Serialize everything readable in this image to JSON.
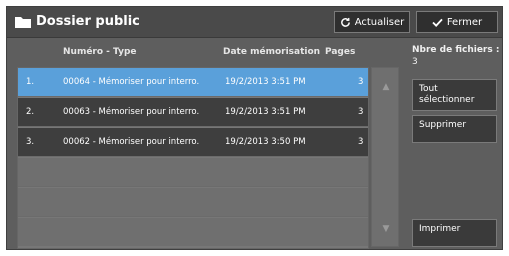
{
  "window": {
    "title": "Dossier public"
  },
  "toolbar": {
    "refresh_label": "Actualiser",
    "close_label": "Fermer"
  },
  "list": {
    "headers": {
      "number_type": "Numéro - Type",
      "date": "Date mémorisation",
      "pages": "Pages"
    },
    "rows": [
      {
        "index": "1.",
        "name": "00064 - Mémoriser pour interro.",
        "date": "19/2/2013 3:51 PM",
        "pages": "3",
        "selected": true
      },
      {
        "index": "2.",
        "name": "00063 - Mémoriser pour interro.",
        "date": "19/2/2013 3:51 PM",
        "pages": "3",
        "selected": false
      },
      {
        "index": "3.",
        "name": "00062 - Mémoriser pour interro.",
        "date": "19/2/2013 3:50 PM",
        "pages": "3",
        "selected": false
      }
    ]
  },
  "sidebar": {
    "file_count_label": "Nbre de fichiers :",
    "file_count_value": "3",
    "select_all_label": "Tout sélectionner",
    "delete_label": "Supprimer",
    "print_label": "Imprimer"
  },
  "colors": {
    "selected_row": "#5aa0da",
    "row": "#3e3e3e",
    "background": "#5e5e5e"
  }
}
